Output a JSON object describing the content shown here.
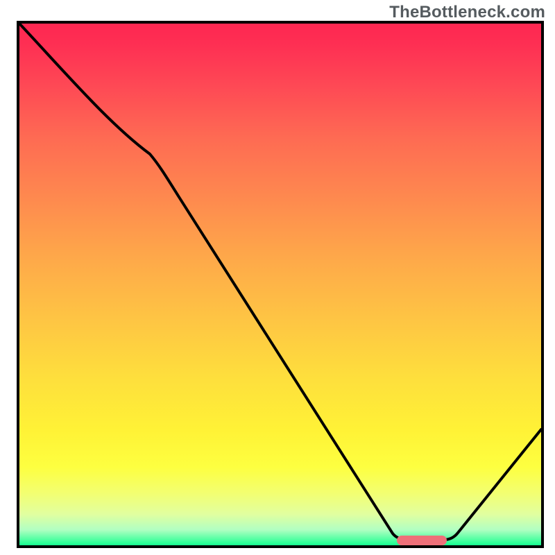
{
  "watermark": "TheBottleneck.com",
  "colors": {
    "border": "#000000",
    "curve": "#000000",
    "marker": "#ee7079"
  },
  "chart_data": {
    "type": "line",
    "title": "",
    "xlabel": "",
    "ylabel": "",
    "xlim": [
      0,
      100
    ],
    "ylim": [
      0,
      100
    ],
    "grid": false,
    "legend": false,
    "series": [
      {
        "name": "curve",
        "x": [
          0,
          25,
          72,
          82,
          100
        ],
        "y": [
          100,
          75,
          2,
          1,
          22
        ]
      }
    ],
    "marker": {
      "x_start": 72,
      "x_end": 82,
      "y": 1
    },
    "background_gradient_stops": [
      {
        "pos": 0,
        "color": "#fe2751"
      },
      {
        "pos": 12,
        "color": "#fe4955"
      },
      {
        "pos": 33,
        "color": "#fe884f"
      },
      {
        "pos": 56,
        "color": "#fec344"
      },
      {
        "pos": 78,
        "color": "#fff236"
      },
      {
        "pos": 94,
        "color": "#e1ff9f"
      },
      {
        "pos": 100,
        "color": "#15ff90"
      }
    ]
  }
}
